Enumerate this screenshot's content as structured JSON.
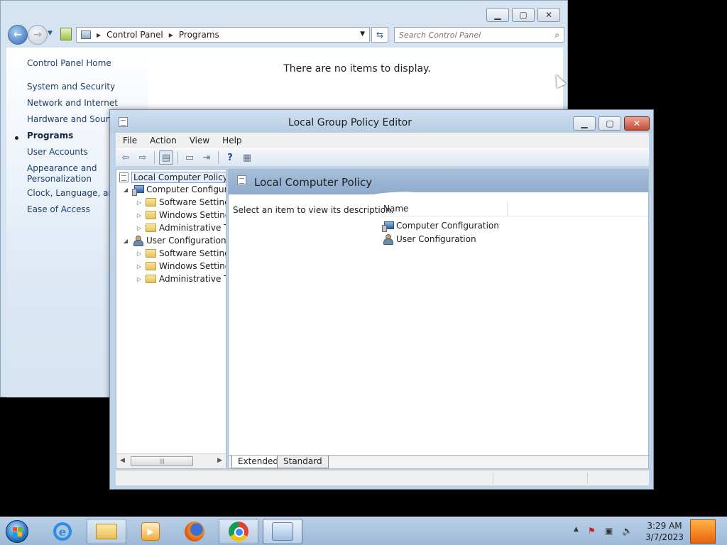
{
  "control_panel": {
    "address": {
      "segments": [
        "Control Panel",
        "Programs"
      ]
    },
    "search": {
      "placeholder": "Search Control Panel"
    },
    "left_nav": {
      "items": [
        {
          "label": "Control Panel Home"
        },
        {
          "label": "System and Security"
        },
        {
          "label": "Network and Internet"
        },
        {
          "label": "Hardware and Sound"
        },
        {
          "label": "Programs",
          "active": true
        },
        {
          "label": "User Accounts"
        },
        {
          "label": "Appearance and"
        },
        {
          "label": "Personalization"
        },
        {
          "label": "Clock, Language, and"
        },
        {
          "label": "Ease of Access"
        }
      ]
    },
    "content": {
      "empty_message": "There are no items to display."
    }
  },
  "gpedit": {
    "title": "Local Group Policy Editor",
    "menu": [
      "File",
      "Action",
      "View",
      "Help"
    ],
    "tree": {
      "root": "Local Computer Policy",
      "computer_config": "Computer Configura",
      "computer_children": [
        "Software Settings",
        "Windows Setting",
        "Administrative Te"
      ],
      "user_config": "User Configuration",
      "user_children": [
        "Software Settings",
        "Windows Setting",
        "Administrative Te"
      ]
    },
    "banner_title": "Local Computer Policy",
    "description": "Select an item to view its description.",
    "list": {
      "column_name": "Name",
      "rows": [
        "Computer Configuration",
        "User Configuration"
      ]
    },
    "tabs": [
      "Extended",
      "Standard"
    ]
  },
  "taskbar": {
    "time": "3:29 AM",
    "date": "3/7/2023"
  },
  "colors": {
    "window_frame": "#bfd3e8",
    "banner": "#8eabcc",
    "taskbar": "#b9cfe6",
    "link": "#1e3f6a"
  }
}
